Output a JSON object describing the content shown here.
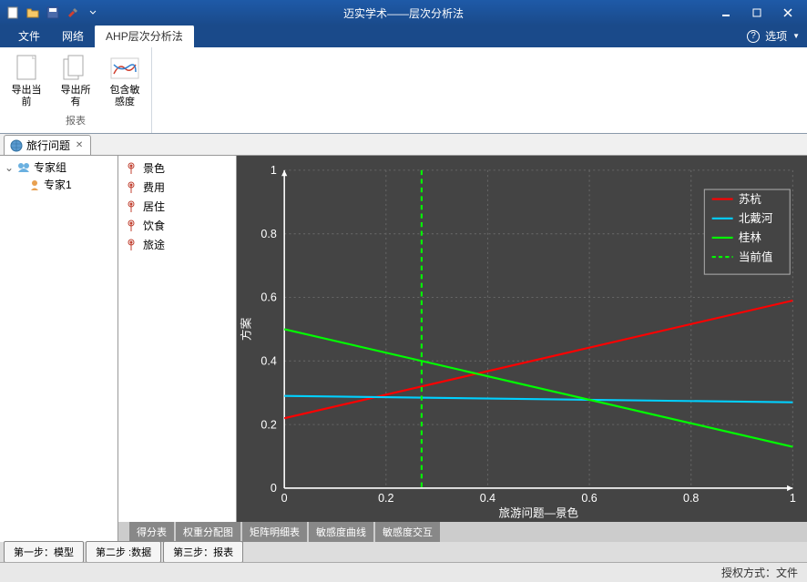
{
  "title": "迈实学术——层次分析法",
  "menus": {
    "file": "文件",
    "network": "网络",
    "ahp": "AHP层次分析法",
    "options": "选项"
  },
  "ribbon": {
    "group_title": "报表",
    "export_current": "导出当前",
    "export_all": "导出所有",
    "include_sensitivity": "包含敏感度"
  },
  "doc_tab": {
    "title": "旅行问题"
  },
  "tree": {
    "root": "专家组",
    "child": "专家1"
  },
  "criteria": [
    "景色",
    "费用",
    "居住",
    "饮食",
    "旅途"
  ],
  "chart_data": {
    "type": "line",
    "xlabel": "旅游问题—景色",
    "ylabel": "方案",
    "xlim": [
      0,
      1
    ],
    "ylim": [
      0,
      1
    ],
    "xticks": [
      0,
      0.2,
      0.4,
      0.6,
      0.8,
      1
    ],
    "yticks": [
      0,
      0.2,
      0.4,
      0.6,
      0.8,
      1
    ],
    "current_value_x": 0.27,
    "series": [
      {
        "name": "苏杭",
        "color": "#ff0000",
        "x": [
          0,
          1
        ],
        "y": [
          0.22,
          0.59
        ]
      },
      {
        "name": "北戴河",
        "color": "#00d0ff",
        "x": [
          0,
          1
        ],
        "y": [
          0.29,
          0.27
        ]
      },
      {
        "name": "桂林",
        "color": "#00ff00",
        "x": [
          0,
          1
        ],
        "y": [
          0.5,
          0.13
        ]
      },
      {
        "name": "当前值",
        "color": "#00ff00",
        "style": "dashed",
        "vline": 0.27
      }
    ]
  },
  "sub_tabs": [
    "得分表",
    "权重分配图",
    "矩阵明细表",
    "敏感度曲线",
    "敏感度交互"
  ],
  "step_tabs": [
    "第一步：模型",
    "第二步 :数据",
    "第三步：报表"
  ],
  "status": "授权方式：文件"
}
